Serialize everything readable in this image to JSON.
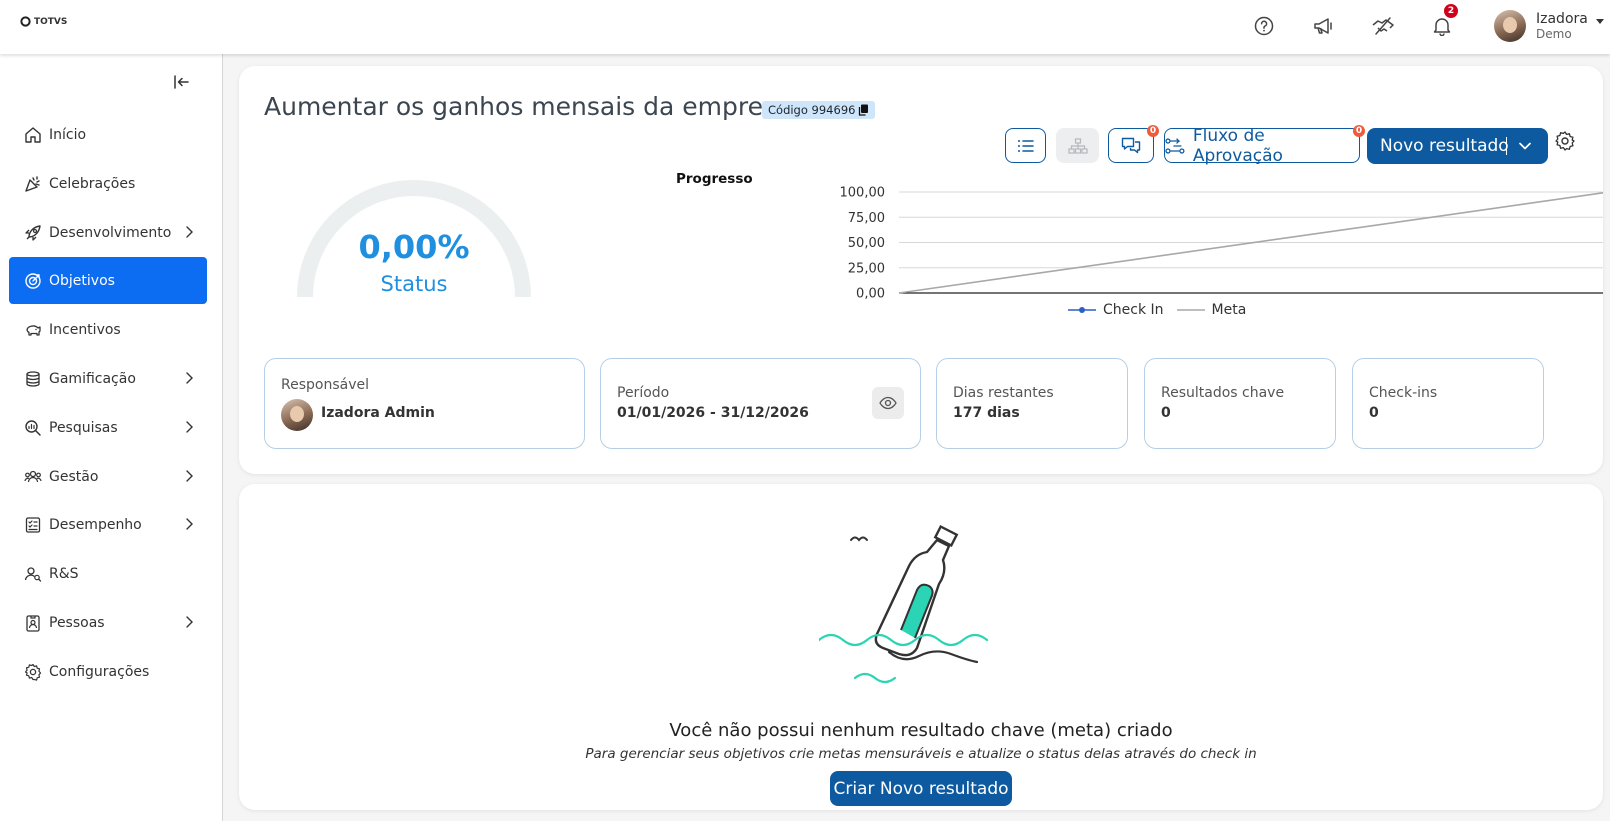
{
  "header": {
    "logo_text": "TOTVS",
    "notification_count": "2",
    "user_name": "Izadora",
    "user_subtitle": "Demo"
  },
  "sidebar": {
    "items": [
      {
        "label": "Início",
        "icon": "home-icon",
        "has_children": false,
        "active": false
      },
      {
        "label": "Celebrações",
        "icon": "party-icon",
        "has_children": false,
        "active": false
      },
      {
        "label": "Desenvolvimento",
        "icon": "rocket-icon",
        "has_children": true,
        "active": false
      },
      {
        "label": "Objetivos",
        "icon": "target-icon",
        "has_children": false,
        "active": true
      },
      {
        "label": "Incentivos",
        "icon": "piggy-bank-icon",
        "has_children": false,
        "active": false
      },
      {
        "label": "Gamificação",
        "icon": "coins-icon",
        "has_children": true,
        "active": false
      },
      {
        "label": "Pesquisas",
        "icon": "search-chart-icon",
        "has_children": true,
        "active": false
      },
      {
        "label": "Gestão",
        "icon": "team-icon",
        "has_children": true,
        "active": false
      },
      {
        "label": "Desempenho",
        "icon": "checklist-icon",
        "has_children": true,
        "active": false
      },
      {
        "label": "R&S",
        "icon": "user-search-icon",
        "has_children": false,
        "active": false
      },
      {
        "label": "Pessoas",
        "icon": "id-badge-icon",
        "has_children": true,
        "active": false
      },
      {
        "label": "Configurações",
        "icon": "gear-icon",
        "has_children": false,
        "active": false
      }
    ]
  },
  "objective": {
    "title": "Aumentar os ganhos mensais da empresa",
    "code_label": "Código 994696"
  },
  "toolbar": {
    "comments_badge": "0",
    "approval_label": "Fluxo de Aprovação",
    "approval_badge": "0",
    "new_result_label": "Novo resultado"
  },
  "status": {
    "value": "0,00%",
    "label": "Status",
    "fraction": 0
  },
  "chart_data": {
    "type": "line",
    "title": "Progresso",
    "ylim": [
      0,
      100
    ],
    "y_ticks": [
      "100,00",
      "75,00",
      "50,00",
      "25,00",
      "0,00"
    ],
    "grid": true,
    "legend_position": "bottom",
    "series": [
      {
        "name": "Check In",
        "color": "#2a5fc4",
        "values": []
      },
      {
        "name": "Meta",
        "color": "#a8a8a8",
        "values": [
          0,
          100
        ]
      }
    ]
  },
  "info_cards": {
    "responsible": {
      "label": "Responsável",
      "value": "Izadora Admin"
    },
    "period": {
      "label": "Período",
      "value": "01/01/2026 - 31/12/2026"
    },
    "days_left": {
      "label": "Dias restantes",
      "value": "177 dias"
    },
    "key_results": {
      "label": "Resultados chave",
      "value": "0"
    },
    "checkins": {
      "label": "Check-ins",
      "value": "0"
    }
  },
  "empty_state": {
    "title": "Você não possui nenhum resultado chave (meta) criado",
    "subtitle": "Para gerenciar seus objetivos crie metas mensuráveis e atualize o status delas através do check in",
    "button_label": "Criar Novo resultado"
  },
  "colors": {
    "primary": "#0e5aa0",
    "sidebar_active": "#0c6cf2",
    "status_blue": "#1f8fe0",
    "badge_red": "#d0021b",
    "illustration_teal": "#2bd4b4"
  }
}
